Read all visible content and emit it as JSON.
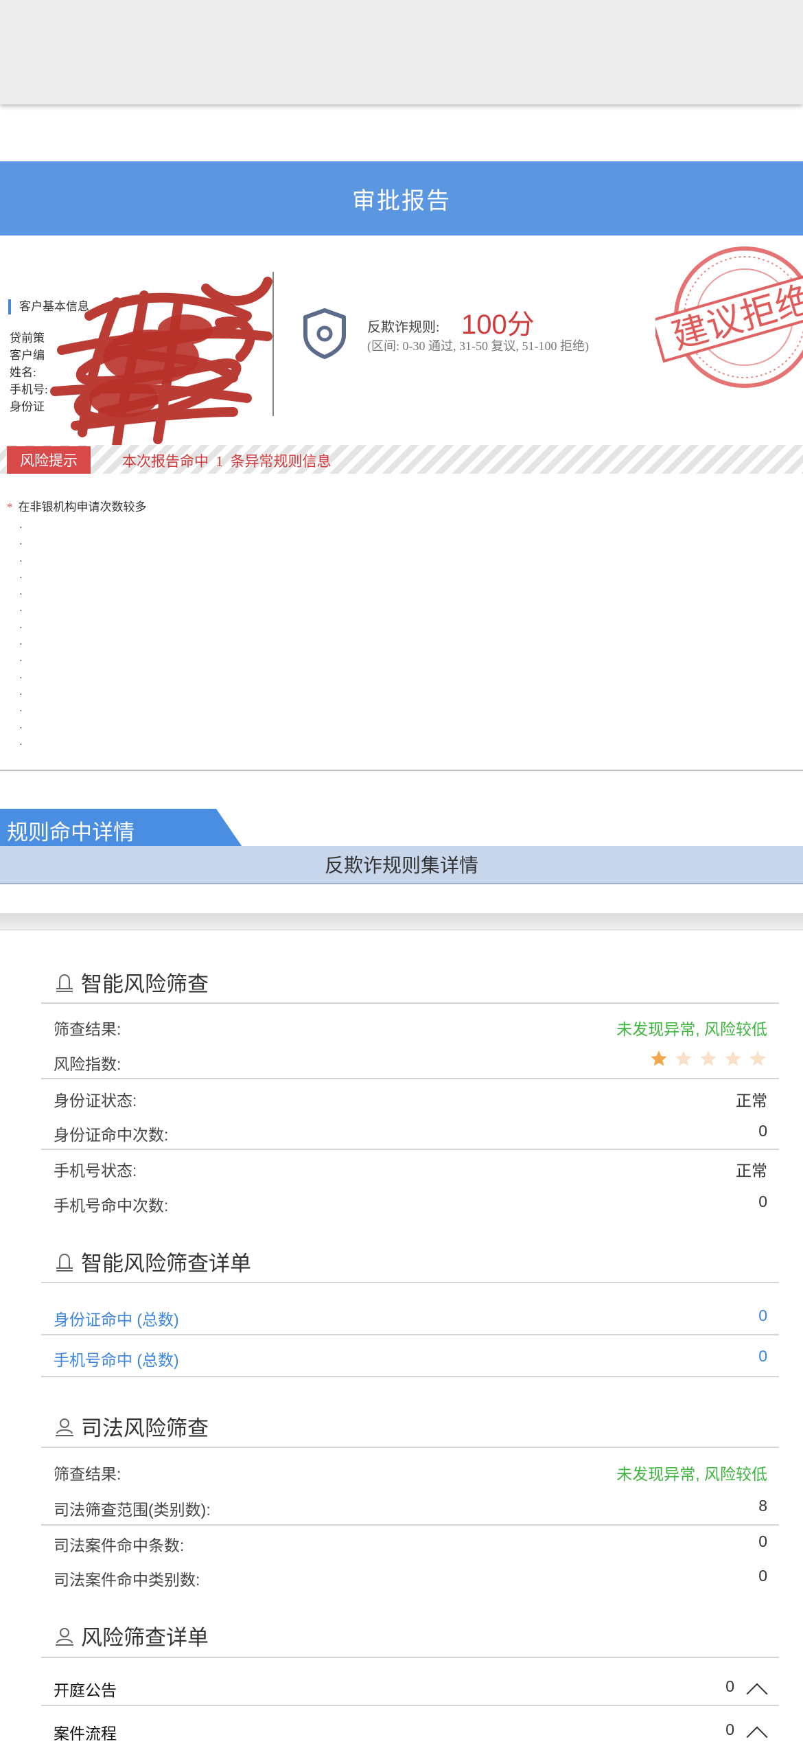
{
  "report": {
    "title": "审批报告"
  },
  "customer_info": {
    "title": "客户基本信息",
    "rows": [
      "贷前策",
      "客户编",
      "姓名:",
      "手机号:",
      "身份证"
    ]
  },
  "anti_fraud": {
    "label": "反欺诈规则:",
    "score": "100分",
    "range": "(区间: 0-30 通过, 31-50 复议, 51-100 拒绝)",
    "stamp_text": "建议拒绝"
  },
  "risk_tip": {
    "tag": "风险提示",
    "message": "本次报告命中  1  条异常规则信息",
    "items": [
      "在非银机构申请次数较多"
    ],
    "dots": [
      ".",
      ".",
      ".",
      ".",
      ".",
      ".",
      ".",
      ".",
      ".",
      ".",
      ".",
      ".",
      ".",
      "."
    ]
  },
  "rule_detail": {
    "tab": "规则命中详情",
    "subheader": "反欺诈规则集详情"
  },
  "smart_screen": {
    "title": "智能风险筛查",
    "result_label": "筛查结果:",
    "result_value": "未发现异常, 风险较低",
    "index_label": "风险指数:",
    "risk_index": 1,
    "risk_index_max": 5,
    "id_status_label": "身份证状态:",
    "id_status_value": "正常",
    "id_hits_label": "身份证命中次数:",
    "id_hits_value": "0",
    "phone_status_label": "手机号状态:",
    "phone_status_value": "正常",
    "phone_hits_label": "手机号命中次数:",
    "phone_hits_value": "0"
  },
  "smart_detail": {
    "title": "智能风险筛查详单",
    "id_total_label": "身份证命中 (总数)",
    "id_total_value": "0",
    "phone_total_label": "手机号命中 (总数)",
    "phone_total_value": "0"
  },
  "judicial": {
    "title": "司法风险筛查",
    "result_label": "筛查结果:",
    "result_value": "未发现异常, 风险较低",
    "scope_label": "司法筛查范围(类别数):",
    "scope_value": "8",
    "case_hits_label": "司法案件命中条数:",
    "case_hits_value": "0",
    "category_hits_label": "司法案件命中类别数:",
    "category_hits_value": "0"
  },
  "risk_detail": {
    "title": "风险筛查详单",
    "court_notice_label": "开庭公告",
    "court_notice_value": "0",
    "case_process_label": "案件流程",
    "case_process_value": "0"
  },
  "colors": {
    "banner": "#5b97e0",
    "danger": "#d84a4a",
    "success": "#3eb53e",
    "link": "#3b86dc",
    "star_active": "#f0a84a",
    "star_inactive": "#f9e0c8"
  }
}
